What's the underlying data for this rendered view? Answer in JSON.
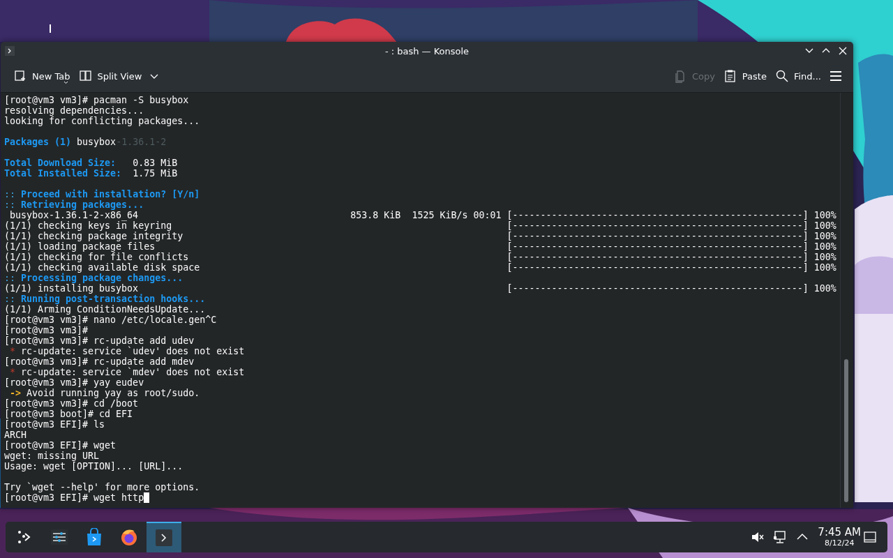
{
  "window": {
    "title": "- : bash — Konsole",
    "controls": [
      {
        "kind": "minimize"
      },
      {
        "kind": "maximize"
      },
      {
        "kind": "close"
      }
    ]
  },
  "toolbar": {
    "left": [
      {
        "kind": "new-tab",
        "label": "New Tab",
        "disabled": false
      },
      {
        "kind": "split-view",
        "label": "Split View",
        "disabled": false
      }
    ],
    "right": [
      {
        "kind": "copy",
        "label": "Copy",
        "disabled": true
      },
      {
        "kind": "paste",
        "label": "Paste",
        "disabled": false
      },
      {
        "kind": "find",
        "label": "Find...",
        "disabled": false
      }
    ]
  },
  "terminal": {
    "cursor_visible": true,
    "lines": [
      {
        "kind": "text",
        "segments": [
          {
            "kind": "plain",
            "t": "[root@vm3 vm3]# pacman -S busybox"
          }
        ]
      },
      {
        "kind": "text",
        "segments": [
          {
            "kind": "plain",
            "t": "resolving dependencies..."
          }
        ]
      },
      {
        "kind": "text",
        "segments": [
          {
            "kind": "plain",
            "t": "looking for conflicting packages..."
          }
        ]
      },
      {
        "kind": "blank"
      },
      {
        "kind": "text",
        "segments": [
          {
            "kind": "heading",
            "t": "Packages (1)"
          },
          {
            "kind": "plain",
            "t": " busybox"
          },
          {
            "kind": "dim",
            "t": "-1.36.1-2"
          }
        ]
      },
      {
        "kind": "blank"
      },
      {
        "kind": "text",
        "segments": [
          {
            "kind": "heading",
            "t": "Total Download Size:"
          },
          {
            "kind": "plain",
            "t": "   0.83 MiB"
          }
        ]
      },
      {
        "kind": "text",
        "segments": [
          {
            "kind": "heading",
            "t": "Total Installed Size:"
          },
          {
            "kind": "plain",
            "t": "  1.75 MiB"
          }
        ]
      },
      {
        "kind": "blank"
      },
      {
        "kind": "text",
        "segments": [
          {
            "kind": "marker",
            "t": "::"
          },
          {
            "kind": "heading",
            "t": " Proceed with installation? [Y/n]"
          }
        ]
      },
      {
        "kind": "text",
        "segments": [
          {
            "kind": "marker",
            "t": "::"
          },
          {
            "kind": "heading",
            "t": " Retrieving packages..."
          }
        ]
      },
      {
        "kind": "progress",
        "segments": [
          {
            "kind": "plain",
            "t": " busybox-1.36.1-2-x86_64"
          }
        ],
        "stats": "853.8 KiB  1525 KiB/s 00:01",
        "bar": "[----------------------------------------------------]",
        "percent": "100%"
      },
      {
        "kind": "progress",
        "segments": [
          {
            "kind": "plain",
            "t": "(1/1) checking keys in keyring"
          }
        ],
        "bar": "[----------------------------------------------------]",
        "percent": "100%"
      },
      {
        "kind": "progress",
        "segments": [
          {
            "kind": "plain",
            "t": "(1/1) checking package integrity"
          }
        ],
        "bar": "[----------------------------------------------------]",
        "percent": "100%"
      },
      {
        "kind": "progress",
        "segments": [
          {
            "kind": "plain",
            "t": "(1/1) loading package files"
          }
        ],
        "bar": "[----------------------------------------------------]",
        "percent": "100%"
      },
      {
        "kind": "progress",
        "segments": [
          {
            "kind": "plain",
            "t": "(1/1) checking for file conflicts"
          }
        ],
        "bar": "[----------------------------------------------------]",
        "percent": "100%"
      },
      {
        "kind": "progress",
        "segments": [
          {
            "kind": "plain",
            "t": "(1/1) checking available disk space"
          }
        ],
        "bar": "[----------------------------------------------------]",
        "percent": "100%"
      },
      {
        "kind": "text",
        "segments": [
          {
            "kind": "marker",
            "t": "::"
          },
          {
            "kind": "heading",
            "t": " Processing package changes..."
          }
        ]
      },
      {
        "kind": "progress",
        "segments": [
          {
            "kind": "plain",
            "t": "(1/1) installing busybox"
          }
        ],
        "bar": "[----------------------------------------------------]",
        "percent": "100%"
      },
      {
        "kind": "text",
        "segments": [
          {
            "kind": "marker",
            "t": "::"
          },
          {
            "kind": "heading",
            "t": " Running post-transaction hooks..."
          }
        ]
      },
      {
        "kind": "text",
        "segments": [
          {
            "kind": "plain",
            "t": "(1/1) Arming ConditionNeedsUpdate..."
          }
        ]
      },
      {
        "kind": "text",
        "segments": [
          {
            "kind": "plain",
            "t": "[root@vm3 vm3]# nano /etc/locale.gen^C"
          }
        ]
      },
      {
        "kind": "text",
        "segments": [
          {
            "kind": "plain",
            "t": "[root@vm3 vm3]#"
          }
        ]
      },
      {
        "kind": "text",
        "segments": [
          {
            "kind": "plain",
            "t": "[root@vm3 vm3]# rc-update add udev"
          }
        ]
      },
      {
        "kind": "text",
        "segments": [
          {
            "kind": "error",
            "t": " *"
          },
          {
            "kind": "plain",
            "t": " rc-update: service `udev' does not exist"
          }
        ]
      },
      {
        "kind": "text",
        "segments": [
          {
            "kind": "plain",
            "t": "[root@vm3 vm3]# rc-update add mdev"
          }
        ]
      },
      {
        "kind": "text",
        "segments": [
          {
            "kind": "error",
            "t": " *"
          },
          {
            "kind": "plain",
            "t": " rc-update: service `mdev' does not exist"
          }
        ]
      },
      {
        "kind": "text",
        "segments": [
          {
            "kind": "plain",
            "t": "[root@vm3 vm3]# yay eudev"
          }
        ]
      },
      {
        "kind": "text",
        "segments": [
          {
            "kind": "arrow",
            "t": " ->"
          },
          {
            "kind": "plain",
            "t": " Avoid running yay as root/sudo."
          }
        ]
      },
      {
        "kind": "text",
        "segments": [
          {
            "kind": "plain",
            "t": "[root@vm3 vm3]# cd /boot"
          }
        ]
      },
      {
        "kind": "text",
        "segments": [
          {
            "kind": "plain",
            "t": "[root@vm3 boot]# cd EFI"
          }
        ]
      },
      {
        "kind": "text",
        "segments": [
          {
            "kind": "plain",
            "t": "[root@vm3 EFI]# ls"
          }
        ]
      },
      {
        "kind": "text",
        "segments": [
          {
            "kind": "plain",
            "t": "ARCH"
          }
        ]
      },
      {
        "kind": "text",
        "segments": [
          {
            "kind": "plain",
            "t": "[root@vm3 EFI]# wget"
          }
        ]
      },
      {
        "kind": "text",
        "segments": [
          {
            "kind": "plain",
            "t": "wget: missing URL"
          }
        ]
      },
      {
        "kind": "text",
        "segments": [
          {
            "kind": "plain",
            "t": "Usage: wget [OPTION]... [URL]..."
          }
        ]
      },
      {
        "kind": "blank"
      },
      {
        "kind": "text",
        "segments": [
          {
            "kind": "plain",
            "t": "Try `wget --help' for more options."
          }
        ]
      },
      {
        "kind": "text",
        "segments": [
          {
            "kind": "plain",
            "t": "[root@vm3 EFI]# wget http"
          }
        ]
      }
    ]
  },
  "taskbar": {
    "apps": [
      {
        "kind": "launcher",
        "selected": false
      },
      {
        "kind": "settings",
        "selected": false
      },
      {
        "kind": "store",
        "selected": false
      },
      {
        "kind": "browser",
        "selected": false
      },
      {
        "kind": "terminal",
        "selected": true
      }
    ],
    "tray": [
      {
        "kind": "volume-muted"
      },
      {
        "kind": "network"
      },
      {
        "kind": "expand"
      }
    ],
    "clock": {
      "time": "7:45 AM",
      "date": "8/12/24"
    }
  }
}
